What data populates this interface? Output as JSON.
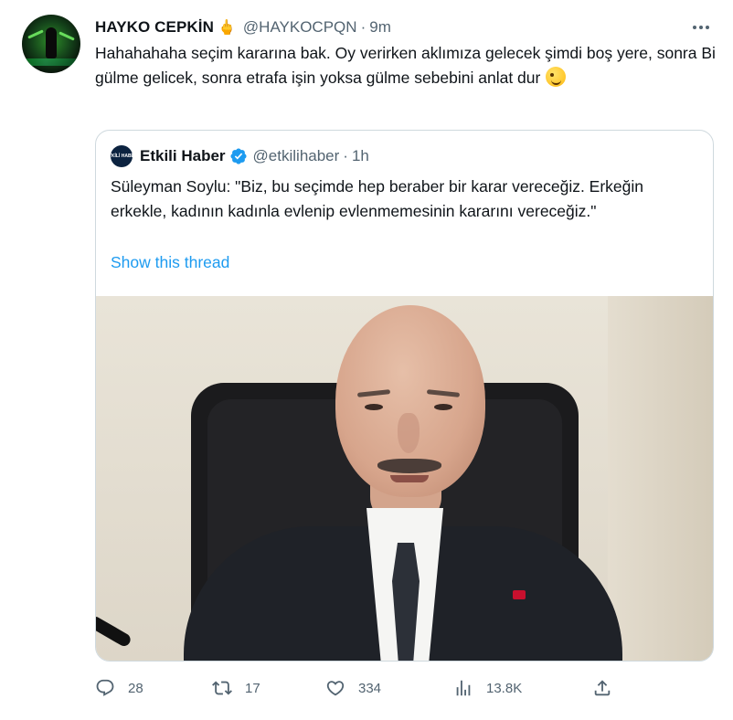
{
  "tweet": {
    "author": {
      "display_name": "HAYKO CEPKİN",
      "name_emoji": "🖕",
      "handle": "@HAYKOCPQN",
      "separator": "·",
      "time": "9m"
    },
    "text": "Hahahahaha seçim kararına bak. Oy verirken aklımıza gelecek şimdi boş yere, sonra Bi gülme gelicek, sonra etrafa işin yoksa gülme sebebini anlat dur",
    "text_emoji": "zany-face-icon",
    "quote": {
      "author": {
        "display_name": "Etkili Haber",
        "avatar_text": "ETKİLİ HABER",
        "verified": true,
        "handle": "@etkilihaber",
        "separator": "·",
        "time": "1h"
      },
      "text": "Süleyman Soylu: \"Biz, bu seçimde hep beraber bir karar vereceğiz. Erkeğin erkekle, kadının kadınla evlenip evlenmemesinin kararını vereceğiz.\"",
      "show_thread_label": "Show this thread",
      "media": "photo-of-man-in-suit"
    },
    "actions": {
      "replies": "28",
      "retweets": "17",
      "likes": "334",
      "views": "13.8K"
    }
  },
  "colors": {
    "text_primary": "#0f1419",
    "text_secondary": "#536471",
    "link": "#1d9bf0",
    "border": "#cfd9de",
    "verified": "#1d9bf0"
  }
}
